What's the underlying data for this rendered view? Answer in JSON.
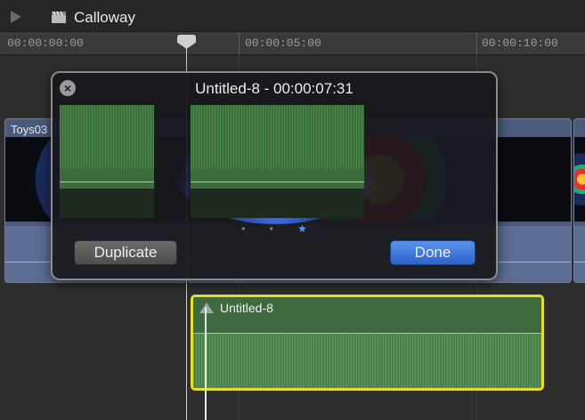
{
  "project": {
    "title": "Calloway"
  },
  "ruler": {
    "timecodes": [
      "00:00:00:00",
      "00:00:05:00",
      "00:00:10:00"
    ]
  },
  "clips": {
    "left_label": "Toys03"
  },
  "popover": {
    "title": "Untitled-8 - 00:00:07:31",
    "close_symbol": "×",
    "pager_dots": "• •",
    "pager_star": "★",
    "duplicate_label": "Duplicate",
    "done_label": "Done"
  },
  "audio_clip": {
    "label": "Untitled-8"
  },
  "colors": {
    "selection": "#e6de2a",
    "accent": "#3a74de"
  }
}
